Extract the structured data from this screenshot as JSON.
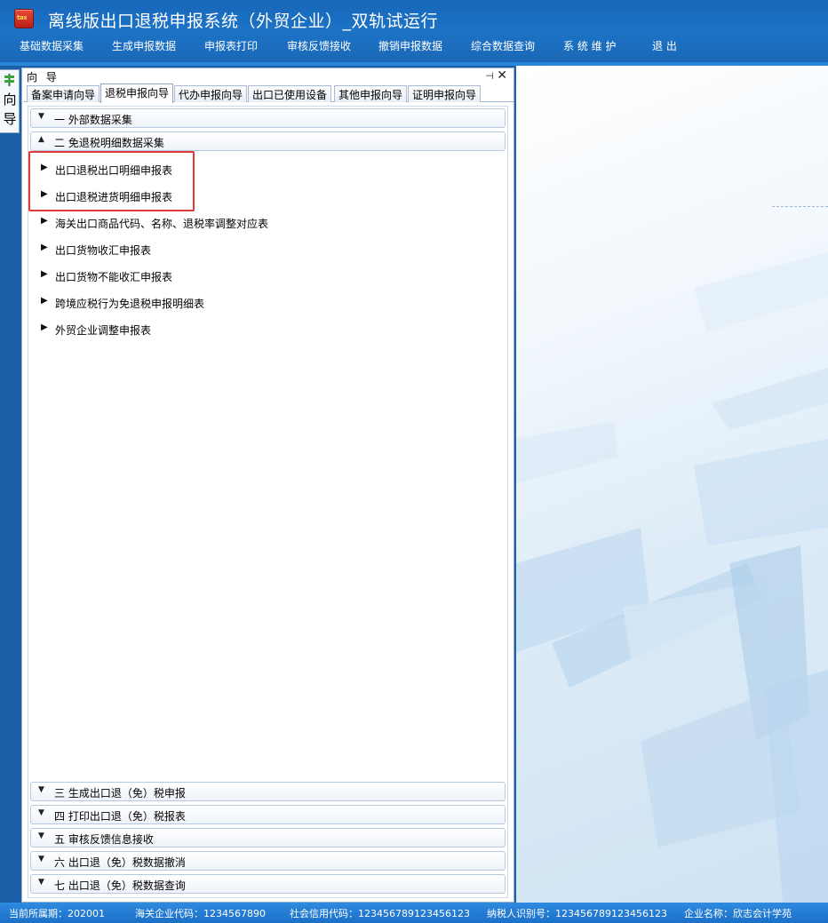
{
  "window": {
    "title": "离线版出口退税申报系统（外贸企业）_双轨试运行",
    "icon_text": "tax"
  },
  "menu": [
    "基础数据采集",
    "生成申报数据",
    "申报表打印",
    "审核反馈接收",
    "撤销申报数据",
    "综合数据查询",
    "系 统 维 护",
    "退  出"
  ],
  "side_tab": {
    "label_1": "向",
    "label_2": "导"
  },
  "panel": {
    "title": "向 导",
    "pin_symbol": "⊣",
    "close_symbol": "✕",
    "tabs": [
      {
        "label": "备案申请向导",
        "active": false
      },
      {
        "label": "退税申报向导",
        "active": true
      },
      {
        "label": "代办申报向导",
        "active": false
      },
      {
        "label": "出口已使用设备",
        "active": false
      },
      {
        "label": "其他申报向导",
        "active": false
      },
      {
        "label": "证明申报向导",
        "active": false
      }
    ],
    "groups": [
      {
        "label": "一  外部数据采集",
        "expanded": false
      },
      {
        "label": "二  免退税明细数据采集",
        "expanded": true
      },
      {
        "label": "三  生成出口退（免）税申报",
        "expanded": false
      },
      {
        "label": "四  打印出口退（免）税报表",
        "expanded": false
      },
      {
        "label": "五  审核反馈信息接收",
        "expanded": false
      },
      {
        "label": "六  出口退（免）税数据撤消",
        "expanded": false
      },
      {
        "label": "七  出口退（免）税数据查询",
        "expanded": false
      }
    ],
    "items": [
      "出口退税出口明细申报表",
      "出口退税进货明细申报表",
      "海关出口商品代码、名称、退税率调整对应表",
      "出口货物收汇申报表",
      "出口货物不能收汇申报表",
      "跨境应税行为免退税申报明细表",
      "外贸企业调整申报表"
    ]
  },
  "status": {
    "period": "当前所属期：202001",
    "customs_code": "海关企业代码：1234567890",
    "credit_code": "社会信用代码：123456789123456123",
    "taxpayer_id": "纳税人识别号：123456789123456123",
    "company": "企业名称：欣志会计学苑"
  },
  "colors": {
    "title_bg": "#1d73c6",
    "status_bg": "#2f8ae0",
    "highlight": "#e03a3a"
  }
}
